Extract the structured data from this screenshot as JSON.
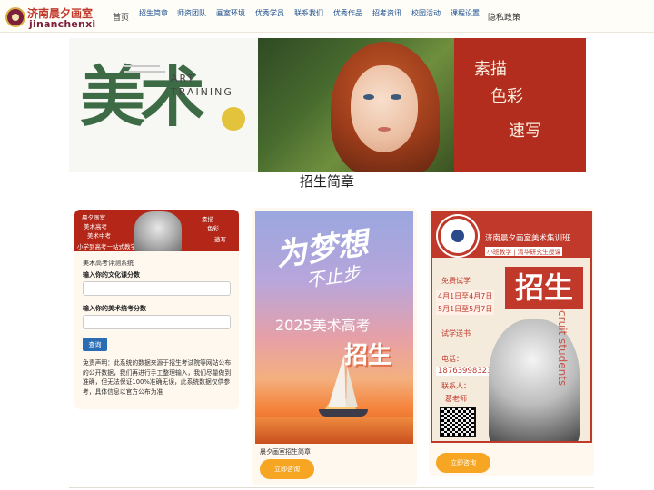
{
  "logo": {
    "cn": "济南晨夕画室",
    "en": "jinanchenxi"
  },
  "nav": {
    "home": "首页",
    "items": [
      "招生简章",
      "师资团队",
      "画室环境",
      "优秀学员",
      "联系我们",
      "优秀作品",
      "招考资讯",
      "校园活动",
      "课程设置"
    ],
    "privacy": "隐私政策"
  },
  "hero": {
    "banner1": {
      "big": "美术",
      "line1": "ART",
      "line2": "TRAINING"
    },
    "banner3": {
      "t1": "素描",
      "t2": "色彩",
      "t3": "速写"
    }
  },
  "section_title": "招生简章",
  "card1": {
    "banner": {
      "l1": "晨夕画室",
      "l2": "美术高考",
      "l3": "美术中考",
      "l4": "小学到高考一站式教学",
      "r1": "素描",
      "r2": "色彩",
      "r3": "速写"
    },
    "form_title": "美术高考评测系统",
    "label_culture": "输入你的文化课分数",
    "label_art": "输入你的美术统考分数",
    "submit": "查询",
    "disclaimer": "免责声明：此系统的数据来源于招生考试院等网站公布的公开数据，我们再进行手工整理输入，我们尽量做到准确，但无法保证100%准确无误，此系统数据仅供参考，具体信息以官方公布为准"
  },
  "card2": {
    "poster": {
      "t1": "为梦想",
      "t2": "不止步",
      "year": "2025美术高考",
      "zhao": "招生"
    },
    "caption": "晨夕画室招生简章",
    "button": "立即咨询"
  },
  "card3": {
    "poster": {
      "title": "济南晨夕画室美术集训班",
      "sub": "小班教学 | 清华研究生授课",
      "free": "免费试学",
      "date1": "4月1日至4月7日",
      "date2": "5月1日至5月7日",
      "zhao": "招生",
      "recruit": "recruit students",
      "try": "试学送书",
      "phone_label": "电话：",
      "phone": "18763998323",
      "contact": "联系人：",
      "teacher": "葛老师"
    },
    "button": "立即咨询"
  }
}
